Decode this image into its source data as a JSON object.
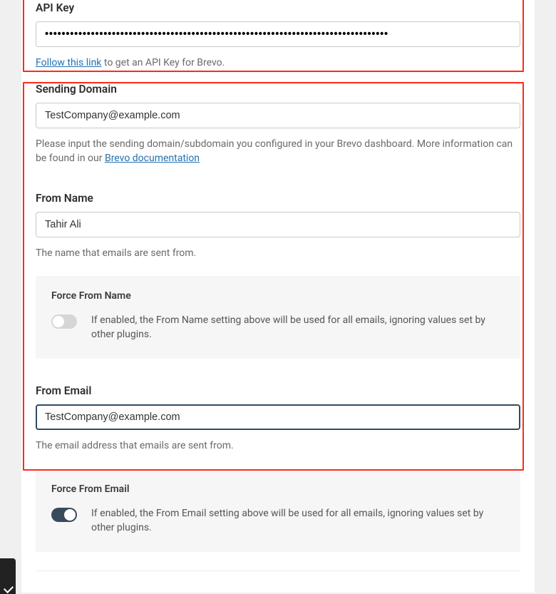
{
  "api_key": {
    "label": "API Key",
    "value": "••••••••••••••••••••••••••••••••••••••••••••••••••••••••••••••••••••••••••••••••••",
    "follow_link_text": "Follow this link",
    "follow_tail": " to get an API Key for Brevo."
  },
  "sending_domain": {
    "label": "Sending Domain",
    "value": "TestCompany@example.com",
    "help_pre": "Please input the sending domain/subdomain you configured in your Brevo dashboard. More information can be found in our ",
    "help_link": "Brevo documentation"
  },
  "from_name": {
    "label": "From Name",
    "value": "Tahir Ali",
    "help": "The name that emails are sent from."
  },
  "force_from_name": {
    "label": "Force From Name",
    "desc": "If enabled, the From Name setting above will be used for all emails, ignoring values set by other plugins.",
    "enabled": false
  },
  "from_email": {
    "label": "From Email",
    "value": "TestCompany@example.com",
    "help": "The email address that emails are sent from."
  },
  "force_from_email": {
    "label": "Force From Email",
    "desc": "If enabled, the From Email setting above will be used for all emails, ignoring values set by other plugins.",
    "enabled": true
  }
}
